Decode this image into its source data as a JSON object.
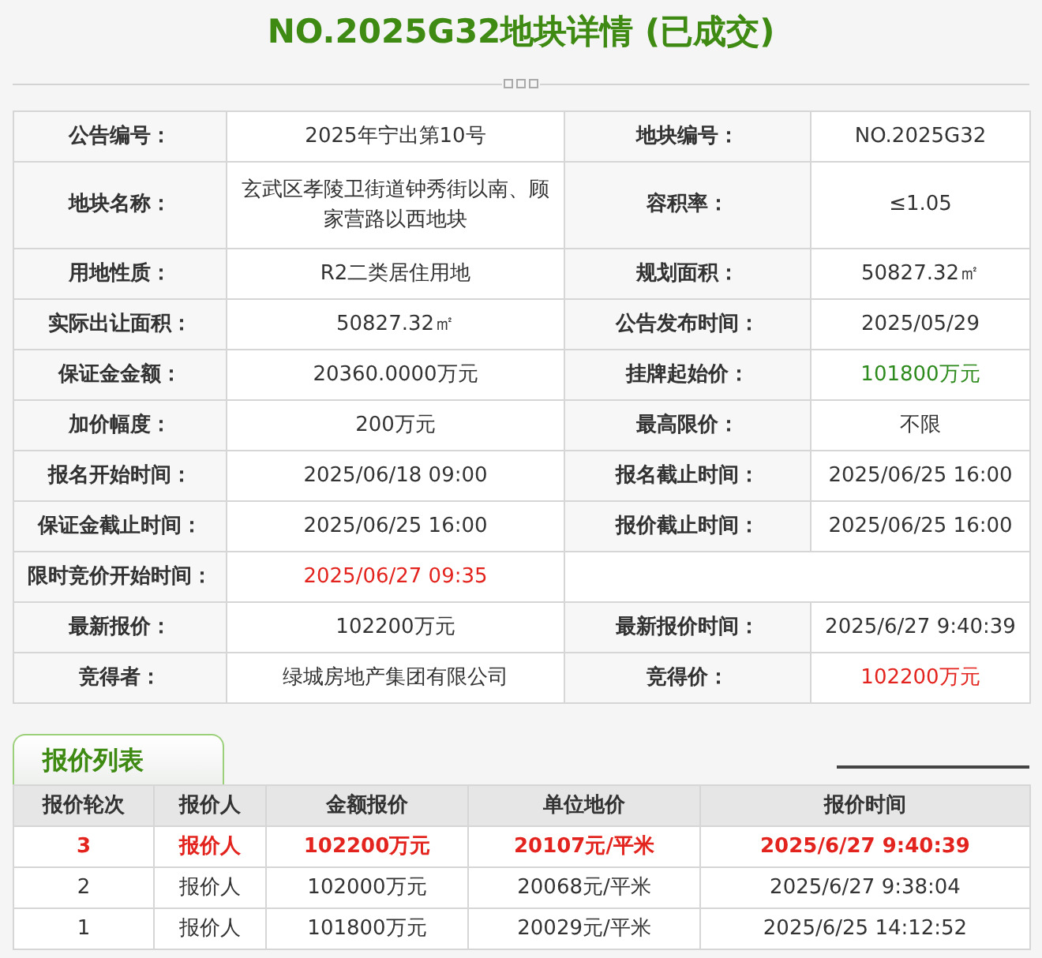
{
  "title": "NO.2025G32地块详情 (已成交)",
  "details": [
    {
      "cells": [
        {
          "label": "公告编号：",
          "value": "2025年宁出第10号"
        },
        {
          "label": "地块编号：",
          "value": "NO.2025G32"
        }
      ]
    },
    {
      "cells": [
        {
          "label": "地块名称：",
          "value": "玄武区孝陵卫街道钟秀街以南、顾家营路以西地块"
        },
        {
          "label": "容积率：",
          "value": "≤1.05"
        }
      ]
    },
    {
      "cells": [
        {
          "label": "用地性质：",
          "value": "R2二类居住用地"
        },
        {
          "label": "规划面积：",
          "value": "50827.32㎡"
        }
      ]
    },
    {
      "cells": [
        {
          "label": "实际出让面积：",
          "value": "50827.32㎡"
        },
        {
          "label": "公告发布时间：",
          "value": "2025/05/29"
        }
      ]
    },
    {
      "cells": [
        {
          "label": "保证金金额：",
          "value": "20360.0000万元"
        },
        {
          "label": "挂牌起始价：",
          "value": "101800万元",
          "color": "#2d8a1c"
        }
      ]
    },
    {
      "cells": [
        {
          "label": "加价幅度：",
          "value": "200万元"
        },
        {
          "label": "最高限价：",
          "value": "不限"
        }
      ]
    },
    {
      "cells": [
        {
          "label": "报名开始时间：",
          "value": "2025/06/18 09:00"
        },
        {
          "label": "报名截止时间：",
          "value": "2025/06/25 16:00"
        }
      ]
    },
    {
      "cells": [
        {
          "label": "保证金截止时间：",
          "value": "2025/06/25 16:00"
        },
        {
          "label": "报价截止时间：",
          "value": "2025/06/25 16:00"
        }
      ]
    },
    {
      "cells": [
        {
          "label": "限时竞价开始时间：",
          "value": "2025/06/27 09:35",
          "color": "#e3231d"
        }
      ]
    },
    {
      "cells": [
        {
          "label": "最新报价：",
          "value": "102200万元"
        },
        {
          "label": "最新报价时间：",
          "value": "2025/6/27 9:40:39"
        }
      ]
    },
    {
      "cells": [
        {
          "label": "竞得者：",
          "value": "绿城房地产集团有限公司"
        },
        {
          "label": "竞得价：",
          "value": "102200万元",
          "color": "#e3231d"
        }
      ]
    }
  ],
  "bids": {
    "tab": "报价列表",
    "columns": [
      "报价轮次",
      "报价人",
      "金额报价",
      "单位地价",
      "报价时间"
    ],
    "rows": [
      {
        "highlight": true,
        "cells": [
          "3",
          "报价人",
          "102200万元",
          "20107元/平米",
          "2025/6/27 9:40:39"
        ]
      },
      {
        "highlight": false,
        "cells": [
          "2",
          "报价人",
          "102000万元",
          "20068元/平米",
          "2025/6/27 9:38:04"
        ]
      },
      {
        "highlight": false,
        "cells": [
          "1",
          "报价人",
          "101800万元",
          "20029元/平米",
          "2025/6/25 14:12:52"
        ]
      }
    ]
  }
}
